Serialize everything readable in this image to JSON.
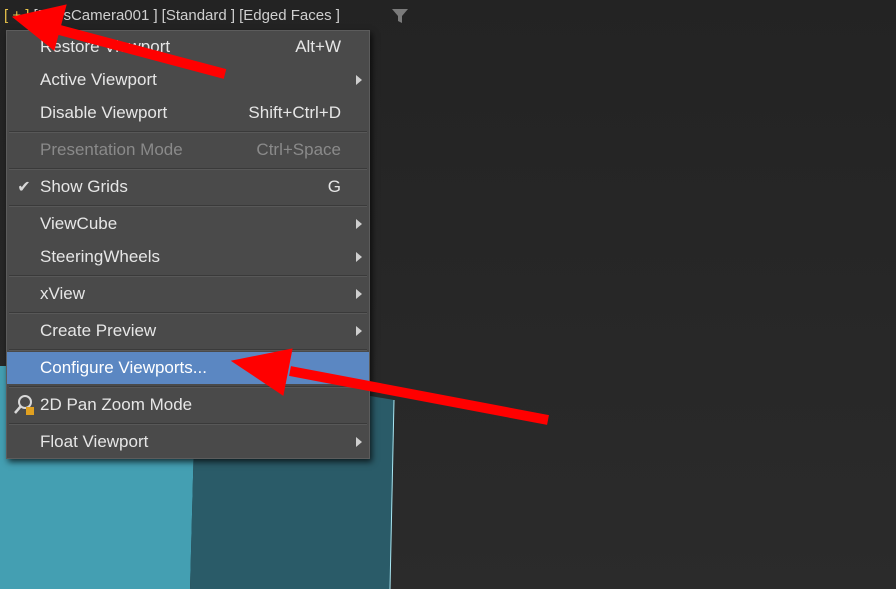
{
  "viewport": {
    "label": {
      "plus": "[ + ]",
      "camera": "[PhysCamera001 ]",
      "shading": "[Standard ]",
      "mode": "[Edged Faces ]"
    },
    "filter_icon": "filter-funnel-icon"
  },
  "menu": {
    "items": [
      {
        "label": "Restore Viewport",
        "shortcut": "Alt+W"
      },
      {
        "label": "Active Viewport",
        "submenu": true
      },
      {
        "label": "Disable Viewport",
        "shortcut": "Shift+Ctrl+D"
      },
      {
        "label": "Presentation Mode",
        "shortcut": "Ctrl+Space",
        "disabled": true
      },
      {
        "label": "Show Grids",
        "shortcut": "G",
        "checked": true
      },
      {
        "label": "ViewCube",
        "submenu": true
      },
      {
        "label": "SteeringWheels",
        "submenu": true
      },
      {
        "label": "xView",
        "submenu": true
      },
      {
        "label": "Create Preview",
        "submenu": true
      },
      {
        "label": "Configure Viewports...",
        "highlighted": true
      },
      {
        "label": "2D Pan Zoom Mode",
        "icon": "pan-zoom-icon"
      },
      {
        "label": "Float Viewport",
        "submenu": true
      }
    ]
  },
  "colors": {
    "menu_bg": "#4a4a4a",
    "highlight": "#5b87c2",
    "annotation_arrow": "#ff0000",
    "scene_teal": "#3f9fb0"
  }
}
